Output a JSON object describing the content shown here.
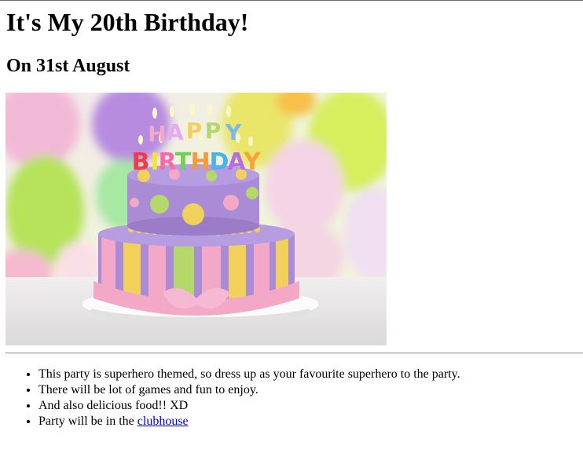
{
  "heading": "It's My 20th Birthday!",
  "subheading": "On 31st August",
  "image": {
    "icon": "birthday-cake-photo",
    "candle_letters_top": [
      "H",
      "A",
      "P",
      "P",
      "Y"
    ],
    "candle_letters_bottom": [
      "B",
      "I",
      "R",
      "T",
      "H",
      "D",
      "A",
      "Y"
    ],
    "colors": {
      "cake_purple": "#a98bd6",
      "cake_pink": "#f4a8c8",
      "cake_yellow": "#f2d15a",
      "cake_green": "#b5d86a"
    }
  },
  "details": {
    "items": [
      "This party is superhero themed, so dress up as your favourite superhero to the party.",
      "There will be lot of games and fun to enjoy.",
      "And also delicious food!! XD"
    ],
    "location_prefix": "Party will be in the ",
    "location_link": "clubhouse"
  }
}
